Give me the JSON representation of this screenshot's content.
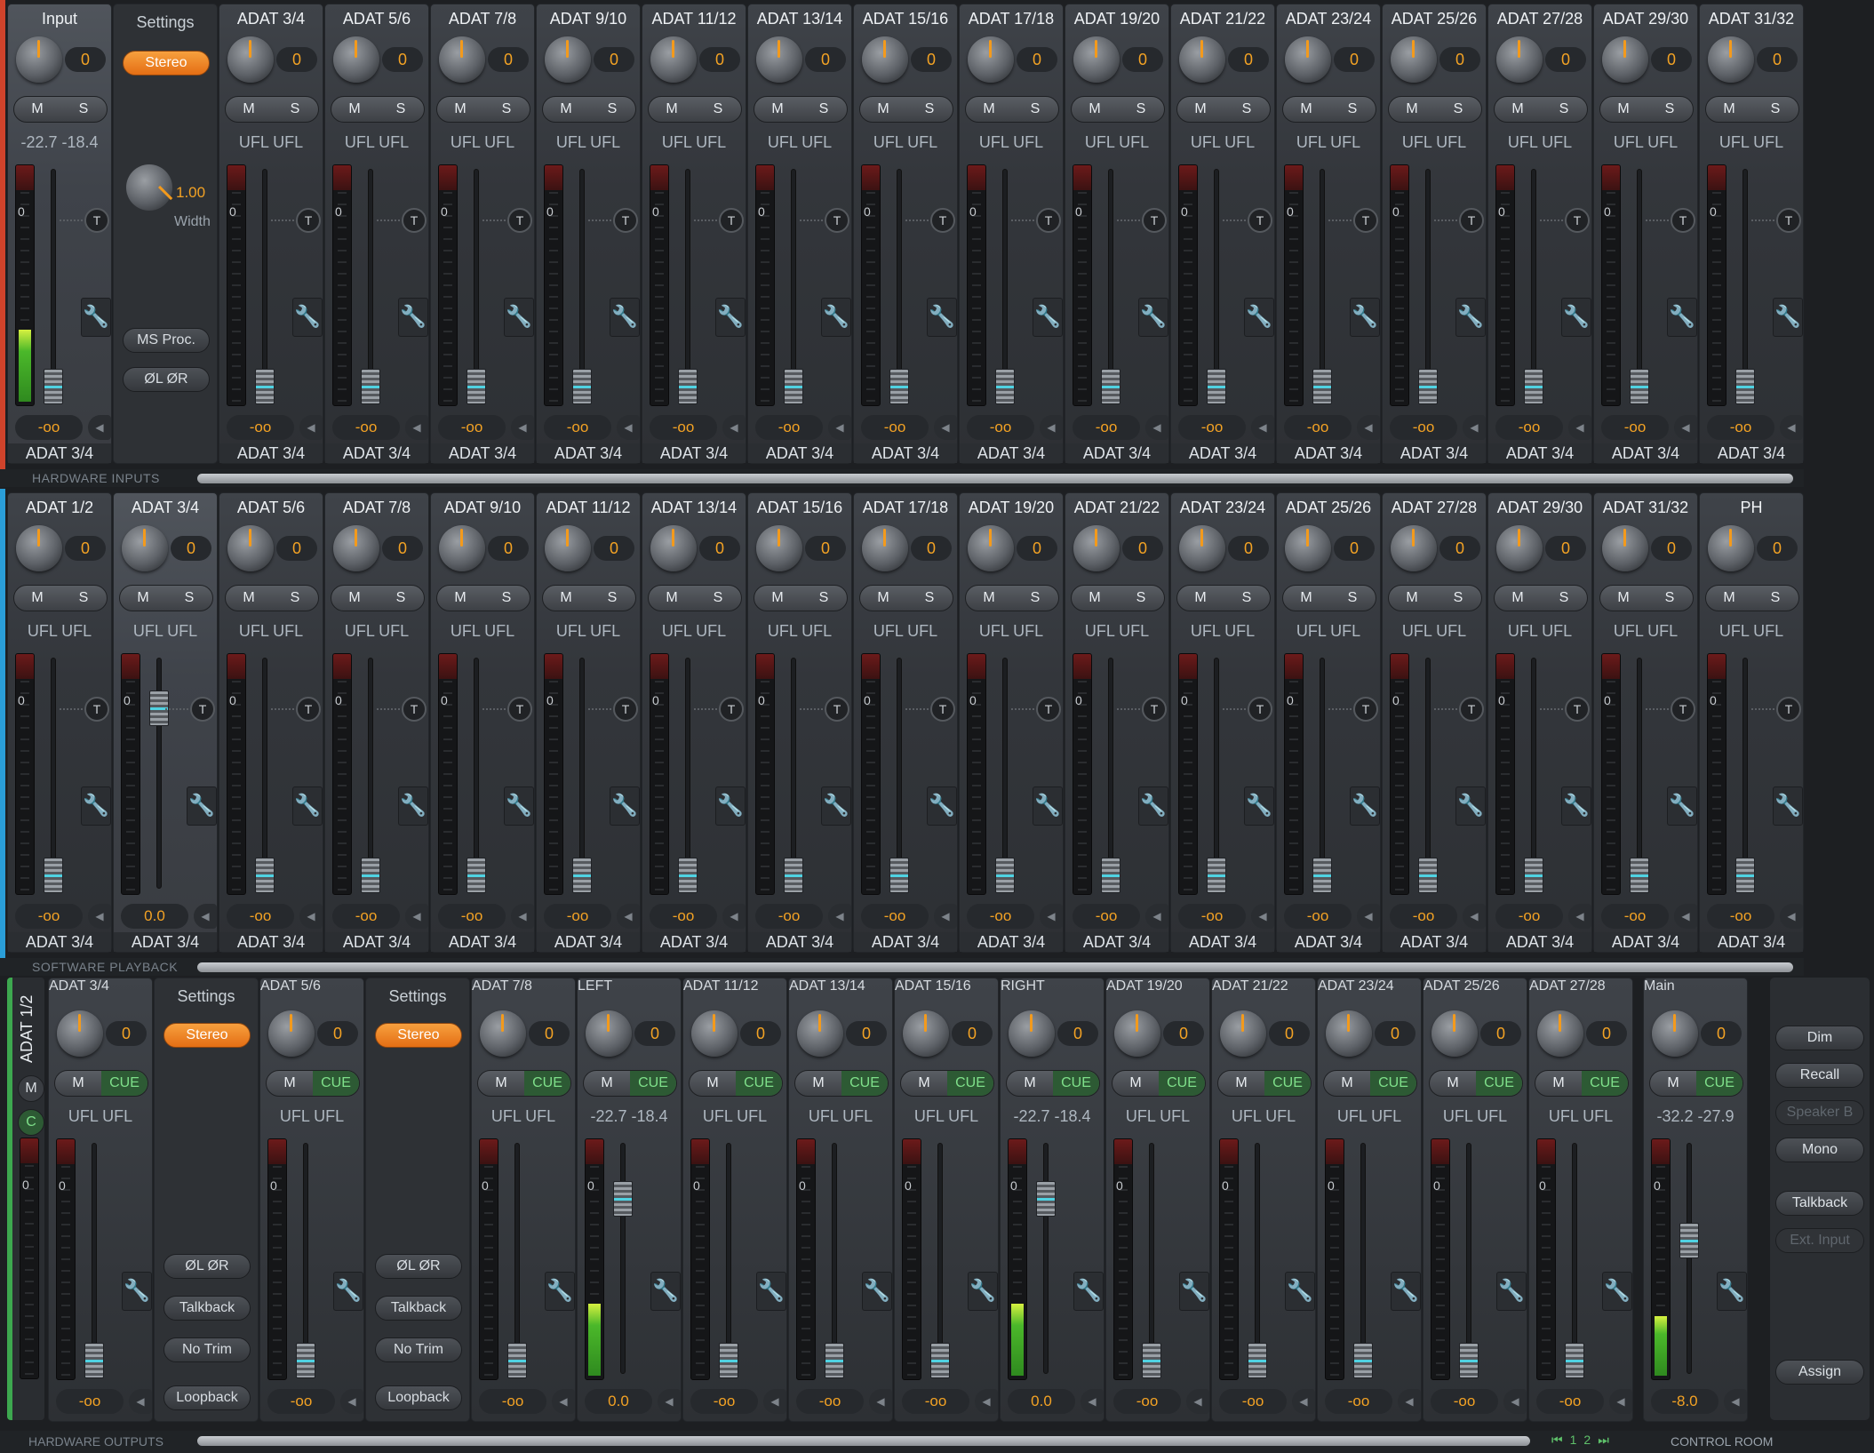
{
  "sections": {
    "hardware_inputs": "HARDWARE INPUTS",
    "software_playback": "SOFTWARE PLAYBACK",
    "hardware_outputs": "HARDWARE OUTPUTS",
    "control_room": "CONTROL ROOM"
  },
  "row1": {
    "input_strip": {
      "name": "Input",
      "knob": "0",
      "m": "M",
      "s": "S",
      "levels": "-22.7 -18.4",
      "fader": "-oo",
      "output": "ADAT 3/4",
      "meter_level": 0.3
    },
    "settings": {
      "title": "Settings",
      "stereo": "Stereo",
      "width_value": "1.00",
      "width_label": "Width",
      "ms_proc": "MS Proc.",
      "phase": "ØL  ØR"
    },
    "channels": [
      {
        "name": "ADAT 3/4",
        "knob": "0",
        "ufl": "UFL  UFL",
        "fader": "-oo",
        "output": "ADAT 3/4"
      },
      {
        "name": "ADAT 5/6",
        "knob": "0",
        "ufl": "UFL  UFL",
        "fader": "-oo",
        "output": "ADAT 3/4"
      },
      {
        "name": "ADAT 7/8",
        "knob": "0",
        "ufl": "UFL  UFL",
        "fader": "-oo",
        "output": "ADAT 3/4"
      },
      {
        "name": "ADAT 9/10",
        "knob": "0",
        "ufl": "UFL  UFL",
        "fader": "-oo",
        "output": "ADAT 3/4"
      },
      {
        "name": "ADAT 11/12",
        "knob": "0",
        "ufl": "UFL  UFL",
        "fader": "-oo",
        "output": "ADAT 3/4"
      },
      {
        "name": "ADAT 13/14",
        "knob": "0",
        "ufl": "UFL  UFL",
        "fader": "-oo",
        "output": "ADAT 3/4"
      },
      {
        "name": "ADAT 15/16",
        "knob": "0",
        "ufl": "UFL  UFL",
        "fader": "-oo",
        "output": "ADAT 3/4"
      },
      {
        "name": "ADAT 17/18",
        "knob": "0",
        "ufl": "UFL  UFL",
        "fader": "-oo",
        "output": "ADAT 3/4"
      },
      {
        "name": "ADAT 19/20",
        "knob": "0",
        "ufl": "UFL  UFL",
        "fader": "-oo",
        "output": "ADAT 3/4"
      },
      {
        "name": "ADAT 21/22",
        "knob": "0",
        "ufl": "UFL  UFL",
        "fader": "-oo",
        "output": "ADAT 3/4"
      },
      {
        "name": "ADAT 23/24",
        "knob": "0",
        "ufl": "UFL  UFL",
        "fader": "-oo",
        "output": "ADAT 3/4"
      },
      {
        "name": "ADAT 25/26",
        "knob": "0",
        "ufl": "UFL  UFL",
        "fader": "-oo",
        "output": "ADAT 3/4"
      },
      {
        "name": "ADAT 27/28",
        "knob": "0",
        "ufl": "UFL  UFL",
        "fader": "-oo",
        "output": "ADAT 3/4"
      },
      {
        "name": "ADAT 29/30",
        "knob": "0",
        "ufl": "UFL  UFL",
        "fader": "-oo",
        "output": "ADAT 3/4"
      },
      {
        "name": "ADAT 31/32",
        "knob": "0",
        "ufl": "UFL  UFL",
        "fader": "-oo",
        "output": "ADAT 3/4"
      }
    ]
  },
  "row2": {
    "channels": [
      {
        "name": "ADAT 1/2",
        "knob": "0",
        "ufl": "UFL  UFL",
        "fader": "-oo",
        "output": "ADAT 3/4"
      },
      {
        "name": "ADAT 3/4",
        "knob": "0",
        "ufl": "UFL  UFL",
        "fader": "0.0",
        "output": "ADAT 3/4",
        "selected": true
      },
      {
        "name": "ADAT 5/6",
        "knob": "0",
        "ufl": "UFL  UFL",
        "fader": "-oo",
        "output": "ADAT 3/4"
      },
      {
        "name": "ADAT 7/8",
        "knob": "0",
        "ufl": "UFL  UFL",
        "fader": "-oo",
        "output": "ADAT 3/4"
      },
      {
        "name": "ADAT 9/10",
        "knob": "0",
        "ufl": "UFL  UFL",
        "fader": "-oo",
        "output": "ADAT 3/4"
      },
      {
        "name": "ADAT 11/12",
        "knob": "0",
        "ufl": "UFL  UFL",
        "fader": "-oo",
        "output": "ADAT 3/4"
      },
      {
        "name": "ADAT 13/14",
        "knob": "0",
        "ufl": "UFL  UFL",
        "fader": "-oo",
        "output": "ADAT 3/4"
      },
      {
        "name": "ADAT 15/16",
        "knob": "0",
        "ufl": "UFL  UFL",
        "fader": "-oo",
        "output": "ADAT 3/4"
      },
      {
        "name": "ADAT 17/18",
        "knob": "0",
        "ufl": "UFL  UFL",
        "fader": "-oo",
        "output": "ADAT 3/4"
      },
      {
        "name": "ADAT 19/20",
        "knob": "0",
        "ufl": "UFL  UFL",
        "fader": "-oo",
        "output": "ADAT 3/4"
      },
      {
        "name": "ADAT 21/22",
        "knob": "0",
        "ufl": "UFL  UFL",
        "fader": "-oo",
        "output": "ADAT 3/4"
      },
      {
        "name": "ADAT 23/24",
        "knob": "0",
        "ufl": "UFL  UFL",
        "fader": "-oo",
        "output": "ADAT 3/4"
      },
      {
        "name": "ADAT 25/26",
        "knob": "0",
        "ufl": "UFL  UFL",
        "fader": "-oo",
        "output": "ADAT 3/4"
      },
      {
        "name": "ADAT 27/28",
        "knob": "0",
        "ufl": "UFL  UFL",
        "fader": "-oo",
        "output": "ADAT 3/4"
      },
      {
        "name": "ADAT 29/30",
        "knob": "0",
        "ufl": "UFL  UFL",
        "fader": "-oo",
        "output": "ADAT 3/4"
      },
      {
        "name": "ADAT 31/32",
        "knob": "0",
        "ufl": "UFL  UFL",
        "fader": "-oo",
        "output": "ADAT 3/4"
      },
      {
        "name": "PH",
        "knob": "0",
        "ufl": "UFL  UFL",
        "fader": "-oo",
        "output": "ADAT 3/4"
      }
    ]
  },
  "row3": {
    "side": {
      "label": "ADAT 1/2",
      "m": "M",
      "c": "C"
    },
    "settings_a": {
      "title": "Settings",
      "stereo": "Stereo",
      "phase": "ØL  ØR",
      "talkback": "Talkback",
      "no_trim": "No Trim",
      "loopback": "Loopback"
    },
    "settings_b": {
      "title": "Settings",
      "stereo": "Stereo",
      "phase": "ØL  ØR",
      "talkback": "Talkback",
      "no_trim": "No Trim",
      "loopback": "Loopback"
    },
    "channels": [
      {
        "name": "ADAT 3/4",
        "knob": "0",
        "ufl": "UFL  UFL",
        "fader": "-oo",
        "selected": true
      },
      {
        "name": "ADAT 5/6",
        "knob": "0",
        "ufl": "UFL  UFL",
        "fader": "-oo"
      },
      {
        "name": "ADAT 7/8",
        "knob": "0",
        "ufl": "UFL  UFL",
        "fader": "-oo"
      },
      {
        "name": "LEFT",
        "knob": "0",
        "ufl": "-22.7 -18.4",
        "fader": "0.0",
        "meter_level": 0.3
      },
      {
        "name": "ADAT 11/12",
        "knob": "0",
        "ufl": "UFL  UFL",
        "fader": "-oo"
      },
      {
        "name": "ADAT 13/14",
        "knob": "0",
        "ufl": "UFL  UFL",
        "fader": "-oo"
      },
      {
        "name": "ADAT 15/16",
        "knob": "0",
        "ufl": "UFL  UFL",
        "fader": "-oo"
      },
      {
        "name": "RIGHT",
        "knob": "0",
        "ufl": "-22.7 -18.4",
        "fader": "0.0",
        "meter_level": 0.3
      },
      {
        "name": "ADAT 19/20",
        "knob": "0",
        "ufl": "UFL  UFL",
        "fader": "-oo"
      },
      {
        "name": "ADAT 21/22",
        "knob": "0",
        "ufl": "UFL  UFL",
        "fader": "-oo"
      },
      {
        "name": "ADAT 23/24",
        "knob": "0",
        "ufl": "UFL  UFL",
        "fader": "-oo"
      },
      {
        "name": "ADAT 25/26",
        "knob": "0",
        "ufl": "UFL  UFL",
        "fader": "-oo"
      },
      {
        "name": "ADAT 27/28",
        "knob": "0",
        "ufl": "UFL  UFL",
        "fader": "-oo"
      }
    ],
    "main": {
      "name": "Main",
      "knob": "0",
      "m": "M",
      "cue": "CUE",
      "levels": "-32.2 -27.9",
      "fader": "-8.0",
      "meter_level": 0.25
    },
    "control_room": {
      "dim": "Dim",
      "recall": "Recall",
      "speaker_b": "Speaker B",
      "mono": "Mono",
      "talkback": "Talkback",
      "ext_input": "Ext. Input",
      "assign": "Assign"
    },
    "pager": {
      "first": "⏮",
      "p1": "1",
      "p2": "2",
      "last": "⏭"
    }
  },
  "colors": {
    "accent": "#f39a1c",
    "hw_in_stripe": "#d0432b",
    "sw_pb_stripe": "#2a9ed8",
    "hw_out_stripe": "#3da84f",
    "cue_green": "#7fe08a",
    "meter_green": "#4bb82a"
  }
}
